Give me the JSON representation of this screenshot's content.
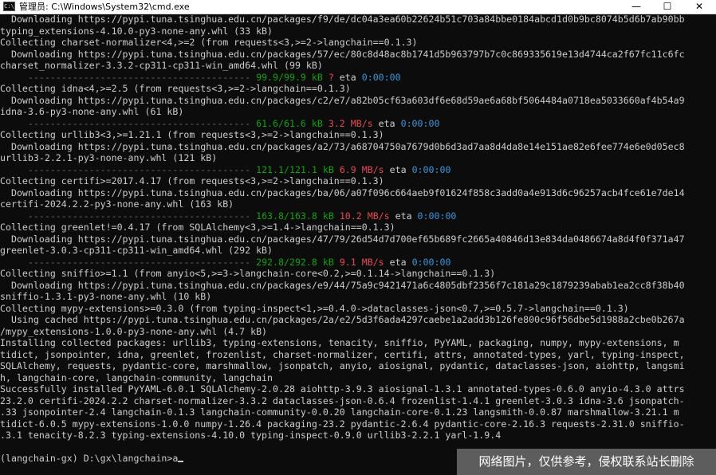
{
  "window": {
    "icon_text": "C:\\",
    "title": "管理员: C:\\Windows\\System32\\cmd.exe",
    "minimize_glyph": "—",
    "maximize_glyph": "☐",
    "close_glyph": "✕"
  },
  "terminal": {
    "lines": [
      {
        "kind": "text",
        "text": "  Downloading https://pypi.tuna.tsinghua.edu.cn/packages/f9/de/dc04a3ea60b22624b51c703a84bbe0184abcd1d0b9bc8074b5d6b7ab90bb"
      },
      {
        "kind": "text",
        "text": "typing_extensions-4.10.0-py3-none-any.whl (33 kB)"
      },
      {
        "kind": "text",
        "text": "Collecting charset-normalizer<4,>=2 (from requests<3,>=2->langchain==0.1.3)"
      },
      {
        "kind": "text",
        "text": "  Downloading https://pypi.tuna.tsinghua.edu.cn/packages/57/ec/80c8d48ac8b1741d5b963797b7c0c869335619e13d4744ca2f67fc11c6fc"
      },
      {
        "kind": "text",
        "text": "charset_normalizer-3.3.2-cp311-cp311-win_amd64.whl (99 kB)"
      },
      {
        "kind": "progress",
        "bar": "     ---------------------------------------- ",
        "size": "99.9/99.9 kB",
        "speed": "?",
        "eta_label": " eta ",
        "eta": "0:00:00"
      },
      {
        "kind": "text",
        "text": "Collecting idna<4,>=2.5 (from requests<3,>=2->langchain==0.1.3)"
      },
      {
        "kind": "text",
        "text": "  Downloading https://pypi.tuna.tsinghua.edu.cn/packages/c2/e7/a82b05cf63a603df6e68d59ae6a68bf5064484a0718ea5033660af4b54a9"
      },
      {
        "kind": "text",
        "text": "idna-3.6-py3-none-any.whl (61 kB)"
      },
      {
        "kind": "progress",
        "bar": "     ---------------------------------------- ",
        "size": "61.6/61.6 kB",
        "speed": "3.2 MB/s",
        "eta_label": " eta ",
        "eta": "0:00:00"
      },
      {
        "kind": "text",
        "text": "Collecting urllib3<3,>=1.21.1 (from requests<3,>=2->langchain==0.1.3)"
      },
      {
        "kind": "text",
        "text": "  Downloading https://pypi.tuna.tsinghua.edu.cn/packages/a2/73/a68704750a7679d0b6d3ad7aa8d4da8e14e151ae82e6fee774e6e0d05ec8"
      },
      {
        "kind": "text",
        "text": "urllib3-2.2.1-py3-none-any.whl (121 kB)"
      },
      {
        "kind": "progress",
        "bar": "     ---------------------------------------- ",
        "size": "121.1/121.1 kB",
        "speed": "6.9 MB/s",
        "eta_label": " eta ",
        "eta": "0:00:00"
      },
      {
        "kind": "text",
        "text": "Collecting certifi>=2017.4.17 (from requests<3,>=2->langchain==0.1.3)"
      },
      {
        "kind": "text",
        "text": "  Downloading https://pypi.tuna.tsinghua.edu.cn/packages/ba/06/a07f096c664aeb9f01624f858c3add0a4e913d6c96257acb4fce61e7de14"
      },
      {
        "kind": "text",
        "text": "certifi-2024.2.2-py3-none-any.whl (163 kB)"
      },
      {
        "kind": "progress",
        "bar": "     ---------------------------------------- ",
        "size": "163.8/163.8 kB",
        "speed": "10.2 MB/s",
        "eta_label": " eta ",
        "eta": "0:00:00"
      },
      {
        "kind": "text",
        "text": "Collecting greenlet!=0.4.17 (from SQLAlchemy<3,>=1.4->langchain==0.1.3)"
      },
      {
        "kind": "text",
        "text": "  Downloading https://pypi.tuna.tsinghua.edu.cn/packages/47/79/26d54d7d700ef65b689fc2665a40846d13e834da0486674a8d4f0f371a47"
      },
      {
        "kind": "text",
        "text": "greenlet-3.0.3-cp311-cp311-win_amd64.whl (292 kB)"
      },
      {
        "kind": "progress",
        "bar": "     ---------------------------------------- ",
        "size": "292.8/292.8 kB",
        "speed": "9.1 MB/s",
        "eta_label": " eta ",
        "eta": "0:00:00"
      },
      {
        "kind": "text",
        "text": "Collecting sniffio>=1.1 (from anyio<5,>=3->langchain-core<0.2,>=0.1.14->langchain==0.1.3)"
      },
      {
        "kind": "text",
        "text": "  Downloading https://pypi.tuna.tsinghua.edu.cn/packages/e9/44/75a9c9421471a6c4805dbf2356f7c181a29c1879239abab1ea2cc8f38b40"
      },
      {
        "kind": "text",
        "text": "sniffio-1.3.1-py3-none-any.whl (10 kB)"
      },
      {
        "kind": "text",
        "text": "Collecting mypy-extensions>=0.3.0 (from typing-inspect<1,>=0.4.0->dataclasses-json<0.7,>=0.5.7->langchain==0.1.3)"
      },
      {
        "kind": "text",
        "text": "  Using cached https://pypi.tuna.tsinghua.edu.cn/packages/2a/e2/5d3f6ada4297caebe1a2add3b126fe800c96f56dbe5d1988a2cbe0b267a"
      },
      {
        "kind": "text",
        "text": "/mypy_extensions-1.0.0-py3-none-any.whl (4.7 kB)"
      },
      {
        "kind": "text",
        "text": "Installing collected packages: urllib3, typing-extensions, tenacity, sniffio, PyYAML, packaging, numpy, mypy-extensions, m"
      },
      {
        "kind": "text",
        "text": "tidict, jsonpointer, idna, greenlet, frozenlist, charset-normalizer, certifi, attrs, annotated-types, yarl, typing-inspect,"
      },
      {
        "kind": "text",
        "text": "SQLAlchemy, requests, pydantic-core, marshmallow, jsonpatch, anyio, aiosignal, pydantic, dataclasses-json, aiohttp, langsmi"
      },
      {
        "kind": "text",
        "text": "h, langchain-core, langchain-community, langchain"
      },
      {
        "kind": "text",
        "text": "Successfully installed PyYAML-6.0.1 SQLAlchemy-2.0.28 aiohttp-3.9.3 aiosignal-1.3.1 annotated-types-0.6.0 anyio-4.3.0 attrs"
      },
      {
        "kind": "text",
        "text": "23.2.0 certifi-2024.2.2 charset-normalizer-3.3.2 dataclasses-json-0.6.4 frozenlist-1.4.1 greenlet-3.0.3 idna-3.6 jsonpatch-"
      },
      {
        "kind": "text",
        "text": ".33 jsonpointer-2.4 langchain-0.1.3 langchain-community-0.0.20 langchain-core-0.1.23 langsmith-0.0.87 marshmallow-3.21.1 m"
      },
      {
        "kind": "text",
        "text": "tidict-6.0.5 mypy-extensions-1.0.0 numpy-1.26.4 packaging-23.2 pydantic-2.6.4 pydantic-core-2.16.3 requests-2.31.0 sniffio-"
      },
      {
        "kind": "text",
        "text": ".3.1 tenacity-8.2.3 typing-extensions-4.10.0 typing-inspect-0.9.0 urllib3-2.2.1 yarl-1.9.4"
      },
      {
        "kind": "text",
        "text": ""
      },
      {
        "kind": "prompt",
        "text": "(langchain-gx) D:\\gx\\langchain>a"
      }
    ]
  },
  "watermark": {
    "text": "网络图片，仅供参考，侵权联系站长删除"
  },
  "colors": {
    "background": "#0c0c0c",
    "text": "#cccccc",
    "progress_bar": "#6a6a6a",
    "progress_size": "#13a10e",
    "speed": "#e74856",
    "eta": "#3a96dd"
  }
}
